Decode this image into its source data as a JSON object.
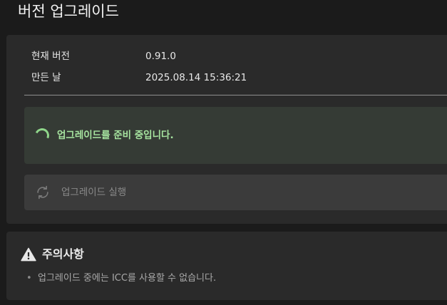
{
  "page": {
    "title": "버전 업그레이드"
  },
  "version_info": {
    "rows": [
      {
        "label": "현재 버전",
        "value": "0.91.0"
      },
      {
        "label": "만든 날",
        "value": "2025.08.14 15:36:21"
      }
    ]
  },
  "status": {
    "message": "업그레이드를 준비 중입니다.",
    "color": "#a6e39f"
  },
  "actions": {
    "run_upgrade_label": "업그레이드 실행",
    "run_upgrade_icon": "refresh-icon",
    "run_upgrade_enabled": false
  },
  "notice": {
    "title": "주의사항",
    "icon": "warning-icon",
    "bullet": "•",
    "items": [
      "업그레이드 중에는 ICC를 사용할 수 없습니다."
    ]
  }
}
